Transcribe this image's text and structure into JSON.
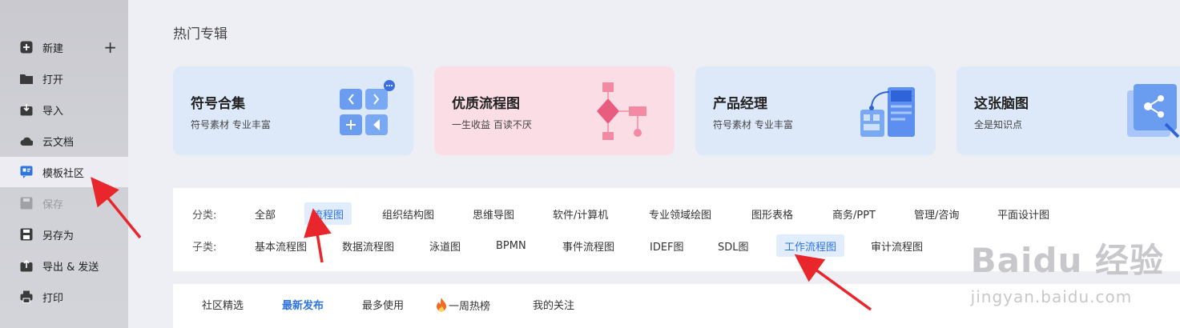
{
  "sidebar": {
    "items": [
      {
        "label": "新建",
        "icon": "plus-square-icon"
      },
      {
        "label": "打开",
        "icon": "folder-icon"
      },
      {
        "label": "导入",
        "icon": "import-icon"
      },
      {
        "label": "云文档",
        "icon": "cloud-icon"
      },
      {
        "label": "模板社区",
        "icon": "template-community-icon"
      },
      {
        "label": "保存",
        "icon": "save-icon"
      },
      {
        "label": "另存为",
        "icon": "save-as-icon"
      },
      {
        "label": "导出 & 发送",
        "icon": "export-icon"
      },
      {
        "label": "打印",
        "icon": "print-icon"
      }
    ],
    "new_plus": "+"
  },
  "main": {
    "section_title": "热门专辑",
    "cards": [
      {
        "title": "符号合集",
        "subtitle": "符号素材 专业丰富",
        "color": "#dde9f9"
      },
      {
        "title": "优质流程图",
        "subtitle": "一生收益 百读不厌",
        "color": "#fbdde5"
      },
      {
        "title": "产品经理",
        "subtitle": "符号素材 专业丰富",
        "color": "#dde9f9"
      },
      {
        "title": "这张脑图",
        "subtitle": "全是知识点",
        "color": "#dde9f9"
      }
    ],
    "filters": {
      "category_label": "分类:",
      "categories": [
        "全部",
        "流程图",
        "组织结构图",
        "思维导图",
        "软件/计算机",
        "专业领域绘图",
        "图形表格",
        "商务/PPT",
        "管理/咨询",
        "平面设计图"
      ],
      "selected_category": "流程图",
      "subcategory_label": "子类:",
      "subcategories": [
        "基本流程图",
        "数据流程图",
        "泳道图",
        "BPMN",
        "事件流程图",
        "IDEF图",
        "SDL图",
        "工作流程图",
        "审计流程图"
      ],
      "selected_subcategory": "工作流程图"
    },
    "tabs": [
      "社区精选",
      "最新发布",
      "最多使用",
      "一周热榜",
      "我的关注"
    ],
    "active_tab": "最新发布"
  },
  "watermark": {
    "big": "Baidu 经验",
    "small": "jingyan.baidu.com"
  },
  "colors": {
    "accent": "#2d74e0",
    "arrow": "#e8262c",
    "sidebar_icon": "#3a3a3a",
    "community_icon": "#2d74e0"
  }
}
